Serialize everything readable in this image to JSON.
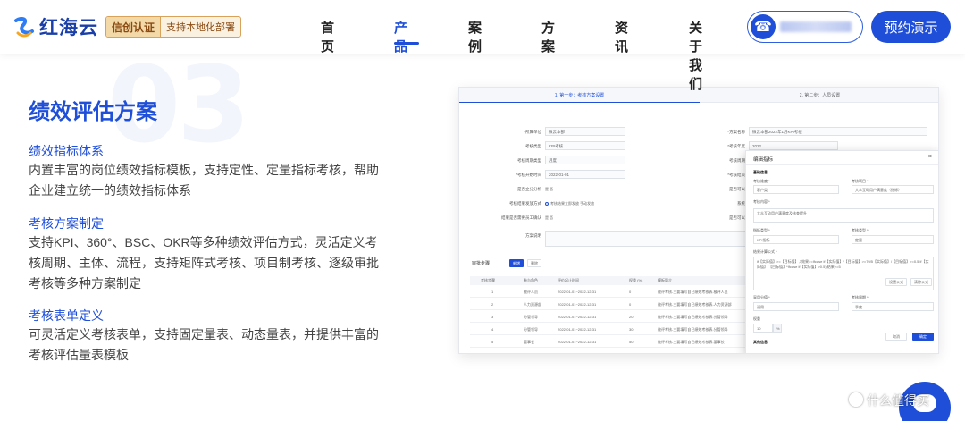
{
  "nav": {
    "logo_text": "红海云",
    "badge_main": "信创认证",
    "badge_sub": "支持本地化部署",
    "menu": [
      {
        "label": "首页"
      },
      {
        "label": "产品"
      },
      {
        "label": "案例"
      },
      {
        "label": "方案"
      },
      {
        "label": "资讯"
      },
      {
        "label": "关于我们"
      }
    ],
    "active_item": "产品",
    "demo_button": "预约演示",
    "phone_icon": "phone-icon"
  },
  "section": {
    "number": "03",
    "title": "绩效评估方案",
    "blocks": [
      {
        "heading": "绩效指标体系",
        "body": "内置丰富的岗位绩效指标模板，支持定性、定量指标考核，帮助企业建立统一的绩效指标体系"
      },
      {
        "heading": "考核方案制定",
        "body": "支持KPI、360°、BSC、OKR等多种绩效评估方式，灵活定义考核周期、主体、流程，支持矩阵式考核、项目制考核、逐级审批考核等多种方案制定"
      },
      {
        "heading": "考核表单定义",
        "body": "可灵活定义考核表单，支持固定量表、动态量表，并提供丰富的考核评估量表模板"
      }
    ]
  },
  "mock": {
    "step1": "1. 第一步：考核方案设置",
    "step2": "2. 第二步：人员设置",
    "form": [
      {
        "label": "*所属单位",
        "value": "微云本部"
      },
      {
        "label": "考核类型",
        "value": "KPI考核"
      },
      {
        "label": "考核周期类型",
        "value": "月度"
      },
      {
        "label": "*考核开始时间",
        "value": "2022-01-01"
      },
      {
        "label": "是否立分分析",
        "value": "是 否"
      },
      {
        "label": "考核结果发放方式",
        "value": "考核结果立即发放 手动发放"
      },
      {
        "label": "结果是否需要员工确认",
        "value": "是 否"
      },
      {
        "label": "方案说明",
        "value": ""
      }
    ],
    "form_right": [
      {
        "label": "*方案名称",
        "value": "微云本部2022年1月KPI考核"
      },
      {
        "label": "*考核年度",
        "value": "2022"
      },
      {
        "label": "考核周期",
        "value": ""
      },
      {
        "label": "*考核结束",
        "value": ""
      },
      {
        "label": "是否可以",
        "value": ""
      },
      {
        "label": "系统",
        "value": ""
      },
      {
        "label": "是否可以",
        "value": ""
      }
    ],
    "steps_title": "审批步骤",
    "add_btn": "新增",
    "del_btn": "删除",
    "table_headers": [
      "考核步骤",
      "参与角色",
      "评价起止时间",
      "权重 (%)",
      "模板简介"
    ],
    "table_rows": [
      [
        "1",
        "被评人员",
        "2022-01-01~2022-12-31",
        "0",
        "被评考核-主要填写自己绩效考核表-被评人员"
      ],
      [
        "2",
        "人力资源部",
        "2022-01-01~2022-12-31",
        "0",
        "被评考核-主要填写自己绩效考核表-人力资源部"
      ],
      [
        "3",
        "分管领导",
        "2022-01-01~2022-12-31",
        "20",
        "被评考核-主要填写自己绩效考核表-分管领导"
      ],
      [
        "4",
        "分管领导",
        "2022-01-01~2022-12-31",
        "30",
        "被评考核-主要填写自己绩效考核表-分管领导"
      ],
      [
        "5",
        "董事长",
        "2022-01-01~2022-12-31",
        "50",
        "被评考核-主要填写自己绩效考核表-董事长"
      ]
    ],
    "modal": {
      "title": "编辑指标",
      "section1": "基础信息",
      "f1_label": "考核维度 *",
      "f1_value": "客户类",
      "f2_label": "考核项目 *",
      "f2_value": "大众互动用户满意度（指标）",
      "f3_label": "考核内容 *",
      "f3_value": "大众互动用户满意度及核查提升",
      "f4_label": "指标类型 *",
      "f4_value": "KPI指标",
      "f5_label": "考核类型 *",
      "f5_value": "定量",
      "formula_label": "结果计算公式 *",
      "formula": "if【实际值】>=【目标值】,3效果>=Ifcase if【实际值】/【目标值】>=70/5【实际值】/【目标值】>=0.5 if【实际值】/【目标值】*Ifcase if【实际值】>0.5) 结果>=5",
      "set_formula": "设置公式",
      "clear_formula": "清除公式",
      "f6_label": "采用分值 *",
      "f6_value": "通用",
      "f7_label": "考核周期 *",
      "f7_value": "季度",
      "weight_label": "权重",
      "weight_value": "10",
      "weight_unit": "%",
      "section2": "其他信息",
      "cancel": "取消",
      "ok": "确定",
      "close": "×"
    }
  },
  "watermark": "什么值得买"
}
